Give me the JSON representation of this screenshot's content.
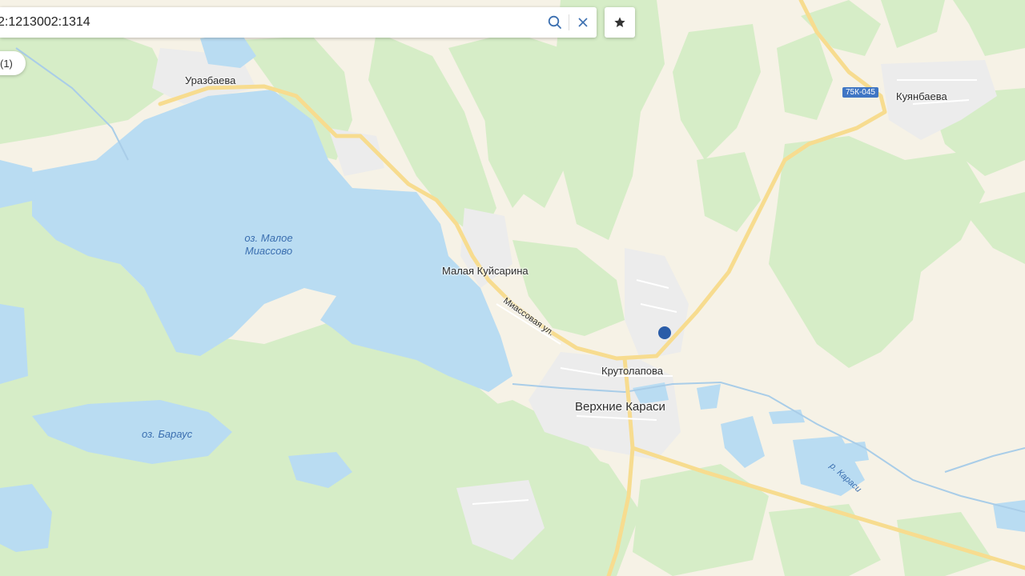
{
  "search": {
    "value": "2:1213002:1314",
    "search_icon": "search-icon",
    "clear_icon": "close-icon"
  },
  "favorite": {
    "icon": "star-icon"
  },
  "filter": {
    "label": "(1)"
  },
  "map": {
    "colors": {
      "land": "#f6f2e6",
      "forest": "#d6edc7",
      "water": "#b9dcf2",
      "road": "#f7dc8f",
      "settlement": "#ececec",
      "marker": "#2a5ca8"
    },
    "places": {
      "urazbaeva": "Уразбаева",
      "kuyanbaeva": "Куянбаева",
      "malaya_kuysarina": "Малая Куйсарина",
      "krutolapova": "Крутолапова",
      "verkhnie_karasi": "Верхние Караси"
    },
    "water_labels": {
      "maloe_miassovo_1": "оз. Малое",
      "maloe_miassovo_2": "Миассово",
      "baraus": "оз. Бараус",
      "karasi_river": "р. Караси"
    },
    "streets": {
      "miassovaya": "Миассовая ул."
    },
    "road_shield": "75К-045"
  }
}
